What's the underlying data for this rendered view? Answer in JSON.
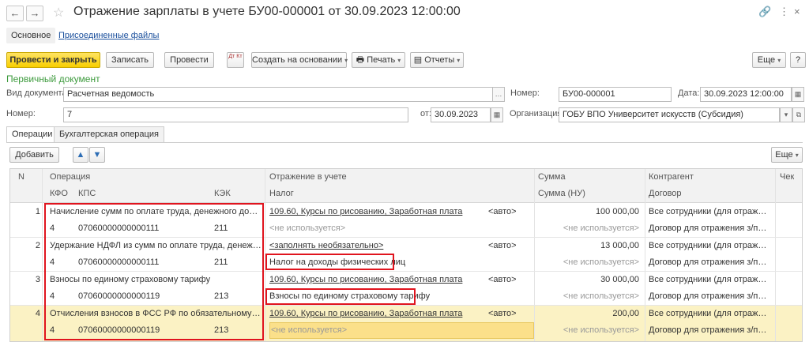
{
  "window": {
    "back_icon": "arrow-left",
    "forward_icon": "arrow-right",
    "title": "Отражение зарплаты в учете БУ00-000001 от 30.09.2023 12:00:00"
  },
  "sections": {
    "main": "Основное",
    "attached_files": "Присоединенные файлы"
  },
  "toolbar": {
    "post_close": "Провести и закрыть",
    "save": "Записать",
    "post": "Провести",
    "dt_kt_icon": "Дт Кт",
    "create_based": "Создать на основании",
    "print": "Печать",
    "reports": "Отчеты",
    "more": "Еще",
    "help": "?"
  },
  "primary_doc": {
    "header": "Первичный документ",
    "doc_type_label": "Вид документа:",
    "doc_type_value": "Расчетная ведомость",
    "number_label": "Номер:",
    "number_value": "7",
    "from_label": "от:",
    "from_value": "30.09.2023"
  },
  "document": {
    "number_label": "Номер:",
    "number_value": "БУ00-000001",
    "date_label": "Дата:",
    "date_value": "30.09.2023 12:00:00",
    "org_label": "Организация:",
    "org_value": "ГОБУ ВПО Университет искусств (Субсидия)"
  },
  "tabs": [
    "Операции",
    "Бухгалтерская операция"
  ],
  "table_toolbar": {
    "add": "Добавить",
    "more": "Еще"
  },
  "table": {
    "headers_top": [
      "N",
      "Операция",
      "Отражение в учете",
      "Сумма",
      "Контрагент",
      "Чек"
    ],
    "headers_sub": [
      "КФО",
      "КПС",
      "КЭК",
      "Налог",
      "Сумма (НУ)",
      "Договор"
    ],
    "rows": [
      {
        "n": "1",
        "operation": "Начисление сумм по оплате труда, денежного довольст...",
        "reflection": "109.60, Курсы по рисованию, Заработная плата",
        "auto": "<авто>",
        "sum": "100 000,00",
        "counterparty": "Все сотрудники (для отражения ...",
        "kfo": "4",
        "kps": "07060000000000111",
        "kek": "211",
        "tax": "<не используется>",
        "sum_nu": "<не используется>",
        "contract": "Договор для отражения з/пл в у..."
      },
      {
        "n": "2",
        "operation": "Удержание НДФЛ из сумм по оплате труда, денежного ...",
        "reflection": "<заполнять необязательно>",
        "auto": "<авто>",
        "sum": "13 000,00",
        "counterparty": "Все сотрудники (для отражения ...",
        "kfo": "4",
        "kps": "07060000000000111",
        "kek": "211",
        "tax": "Налог на доходы физических лиц",
        "sum_nu": "<не используется>",
        "contract": "Договор для отражения з/пл в у..."
      },
      {
        "n": "3",
        "operation": "Взносы по единому страховому тарифу",
        "reflection": "109.60, Курсы по рисованию, Заработная плата",
        "auto": "<авто>",
        "sum": "30 000,00",
        "counterparty": "Все сотрудники (для отражения ...",
        "kfo": "4",
        "kps": "07060000000000119",
        "kek": "213",
        "tax": "Взносы по единому страховому тарифу",
        "sum_nu": "<не используется>",
        "contract": "Договор для отражения з/пл в у..."
      },
      {
        "n": "4",
        "operation": "Отчисления взносов в ФСС РФ по обязательному социа...",
        "reflection": "109.60, Курсы по рисованию, Заработная плата",
        "auto": "<авто>",
        "sum": "200,00",
        "counterparty": "Все сотрудники (для отражения ...",
        "kfo": "4",
        "kps": "07060000000000119",
        "kek": "213",
        "tax": "<не используется>",
        "sum_nu": "<не используется>",
        "contract": "Договор для отражения з/пл в у..."
      }
    ]
  },
  "colors": {
    "primary_button": "#f8ce00",
    "section_header": "#3c9a3c",
    "selected_row": "#fbf2c4",
    "highlight_border": "#e0141e",
    "link": "#1a4f9c"
  }
}
